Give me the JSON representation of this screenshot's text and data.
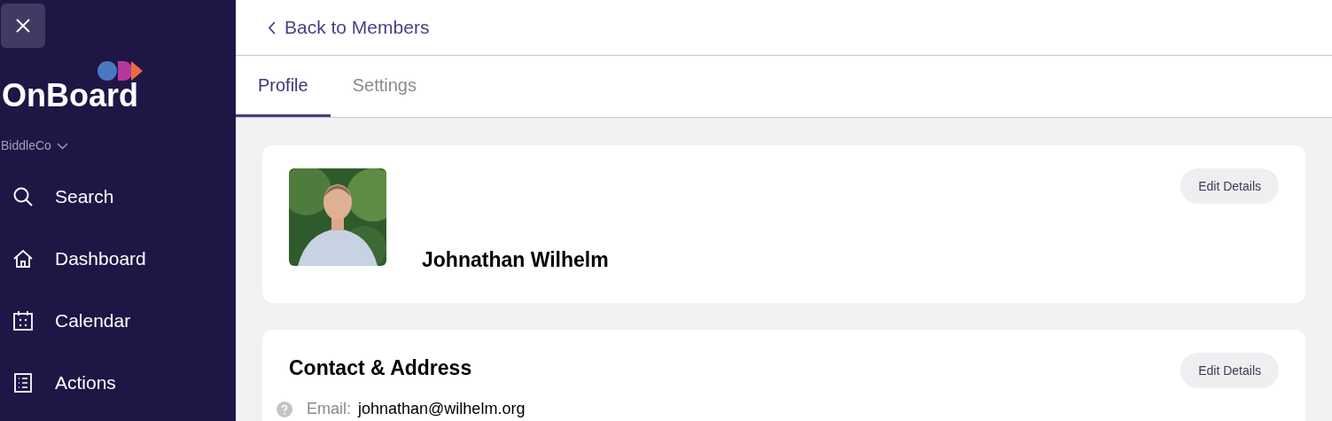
{
  "sidebar": {
    "brand": "OnBoard",
    "organization": "BiddleCo",
    "nav_items": [
      {
        "label": "Search"
      },
      {
        "label": "Dashboard"
      },
      {
        "label": "Calendar"
      },
      {
        "label": "Actions"
      }
    ]
  },
  "back_link": "Back to Members",
  "tabs": [
    {
      "label": "Profile",
      "selected": true
    },
    {
      "label": "Settings",
      "selected": false
    }
  ],
  "profile_card": {
    "name": "Johnathan Wilhelm",
    "edit_button": "Edit Details"
  },
  "contact_card": {
    "title": "Contact & Address",
    "edit_button": "Edit Details",
    "fields": [
      {
        "label": "Email:",
        "value": "johnathan@wilhelm.org"
      }
    ]
  }
}
